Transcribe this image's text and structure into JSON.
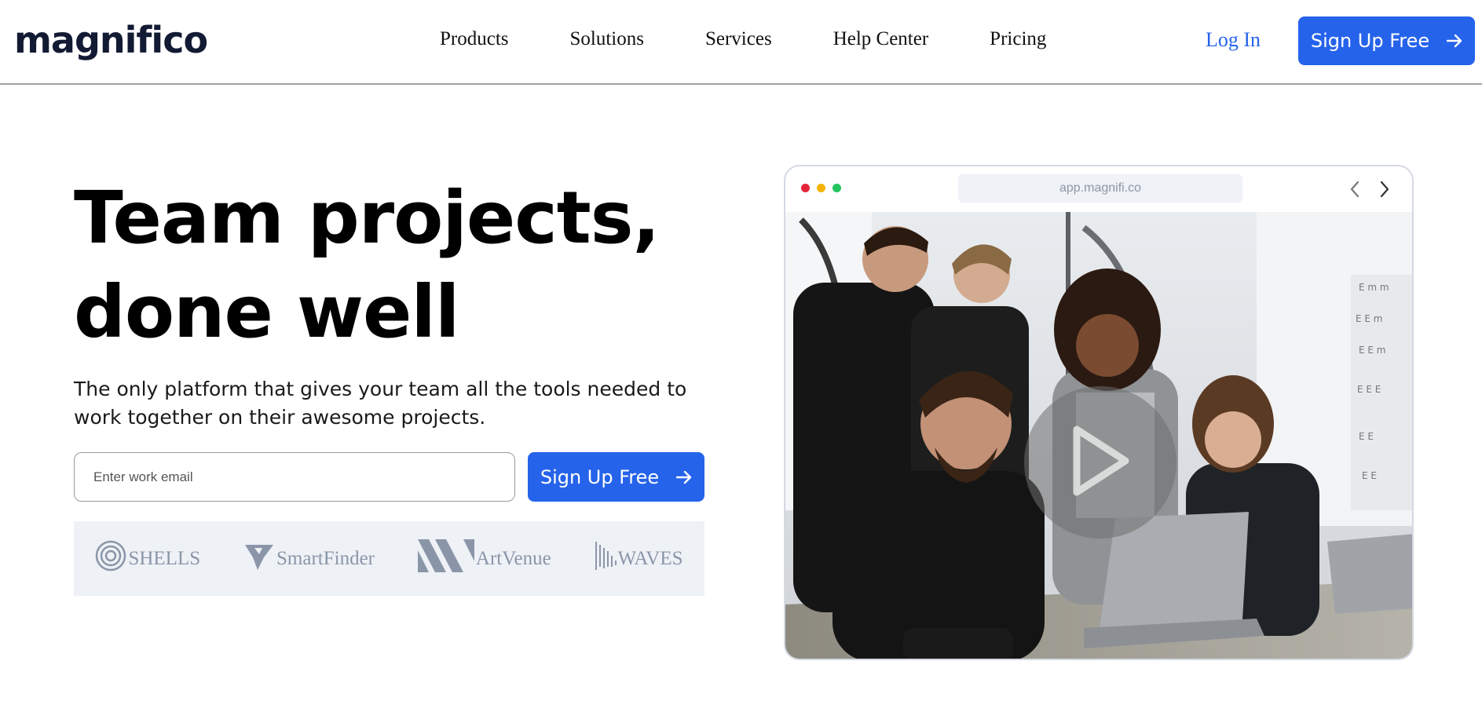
{
  "brand": {
    "logo": "magnifico"
  },
  "nav": {
    "items": [
      "Products",
      "Solutions",
      "Services",
      "Help Center",
      "Pricing"
    ],
    "login": "Log In",
    "signup": "Sign Up Free"
  },
  "hero": {
    "title_line1": "Team projects,",
    "title_line2": "done well",
    "subtitle": "The only platform that gives your team all the tools needed to work together on their awesome projects.",
    "email_placeholder": "Enter work email",
    "signup": "Sign Up Free"
  },
  "trusted_logos": [
    "SHELLS",
    "SmartFinder",
    "ArtVenue",
    "WAVES"
  ],
  "browser": {
    "url": "app.magnifi.co",
    "dot_colors": [
      "#e5243b",
      "#f4b400",
      "#22c55e"
    ]
  },
  "colors": {
    "accent": "#2563eb",
    "logo_text": "#131a33",
    "logo_strip_bg": "#eef1f6"
  }
}
